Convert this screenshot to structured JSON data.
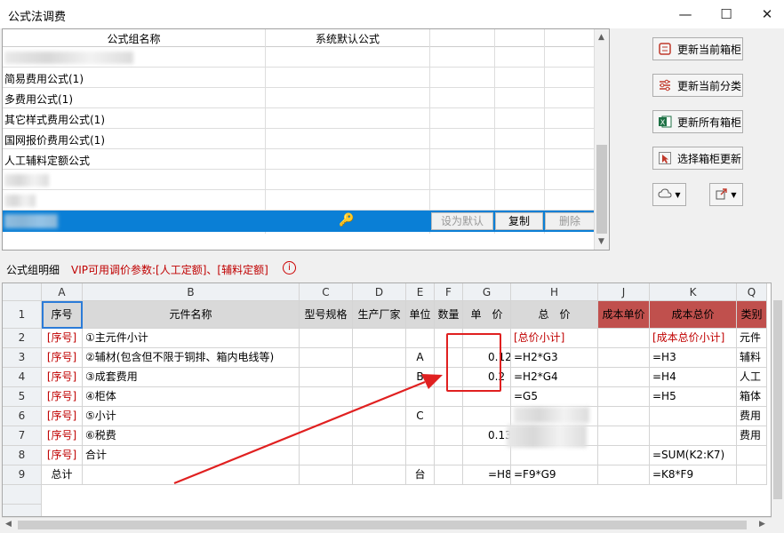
{
  "window": {
    "title": "公式法调费",
    "minimize": "—",
    "maximize": "☐",
    "close": "✕"
  },
  "formula_list": {
    "headers": [
      "公式组名称",
      "系统默认公式"
    ],
    "rows": [
      "",
      "简易费用公式(1)",
      "多费用公式(1)",
      "其它样式费用公式(1)",
      "国网报价费用公式(1)",
      "人工辅料定额公式",
      "",
      ""
    ],
    "selected_actions": {
      "set_default": "设为默认",
      "copy": "复制",
      "delete": "删除"
    }
  },
  "side_buttons": [
    {
      "label": "更新当前箱柜",
      "icon": "cabinet-icon"
    },
    {
      "label": "更新当前分类",
      "icon": "sliders-icon"
    },
    {
      "label": "更新所有箱柜",
      "icon": "excel-icon"
    },
    {
      "label": "选择箱柜更新",
      "icon": "cursor-icon"
    }
  ],
  "section": {
    "label": "公式组明细",
    "vip_note": "VIP可用调价参数:[人工定额]、[辅料定额]",
    "info": "i"
  },
  "sheet": {
    "col_letters": [
      "A",
      "B",
      "C",
      "D",
      "E",
      "F",
      "G",
      "H",
      "J",
      "K",
      "Q"
    ],
    "row_numbers": [
      "1",
      "2",
      "3",
      "4",
      "5",
      "6",
      "7",
      "8",
      "9"
    ],
    "headers": [
      "序号",
      "元件名称",
      "型号规格",
      "生产厂家",
      "单位",
      "数量",
      "单　价",
      "总　价",
      "成本单价",
      "成本总价",
      "类别"
    ],
    "rows": [
      [
        "[序号]",
        "①主元件小计",
        "",
        "",
        "",
        "",
        "",
        "[总价小计]",
        "",
        "[成本总价小计]",
        "元件"
      ],
      [
        "[序号]",
        "②辅材(包含但不限于铜排、箱内电线等)",
        "",
        "",
        "A",
        "",
        "0.12",
        "=H2*G3",
        "",
        "=H3",
        "辅料"
      ],
      [
        "[序号]",
        "③成套费用",
        "",
        "",
        "B",
        "",
        "0.2",
        "=H2*G4",
        "",
        "=H4",
        "人工"
      ],
      [
        "[序号]",
        "④柜体",
        "",
        "",
        "",
        "",
        "",
        "=G5",
        "",
        "=H5",
        "箱体"
      ],
      [
        "[序号]",
        "⑤小计",
        "",
        "",
        "C",
        "",
        "",
        "",
        "",
        "",
        "费用"
      ],
      [
        "[序号]",
        "⑥税费",
        "",
        "",
        "",
        "",
        "0.13",
        "",
        "",
        "",
        "费用"
      ],
      [
        "[序号]",
        "合计",
        "",
        "",
        "",
        "",
        "",
        "",
        "",
        "=SUM(K2:K7)",
        ""
      ],
      [
        "总计",
        "",
        "",
        "",
        "台",
        "",
        "=H8",
        "=F9*G9",
        "",
        "=K8*F9",
        ""
      ]
    ]
  },
  "colors": {
    "selection": "#0a7fd6",
    "cost_header": "#c0504d",
    "annotation": "#e02020",
    "text_red": "#c00000"
  }
}
